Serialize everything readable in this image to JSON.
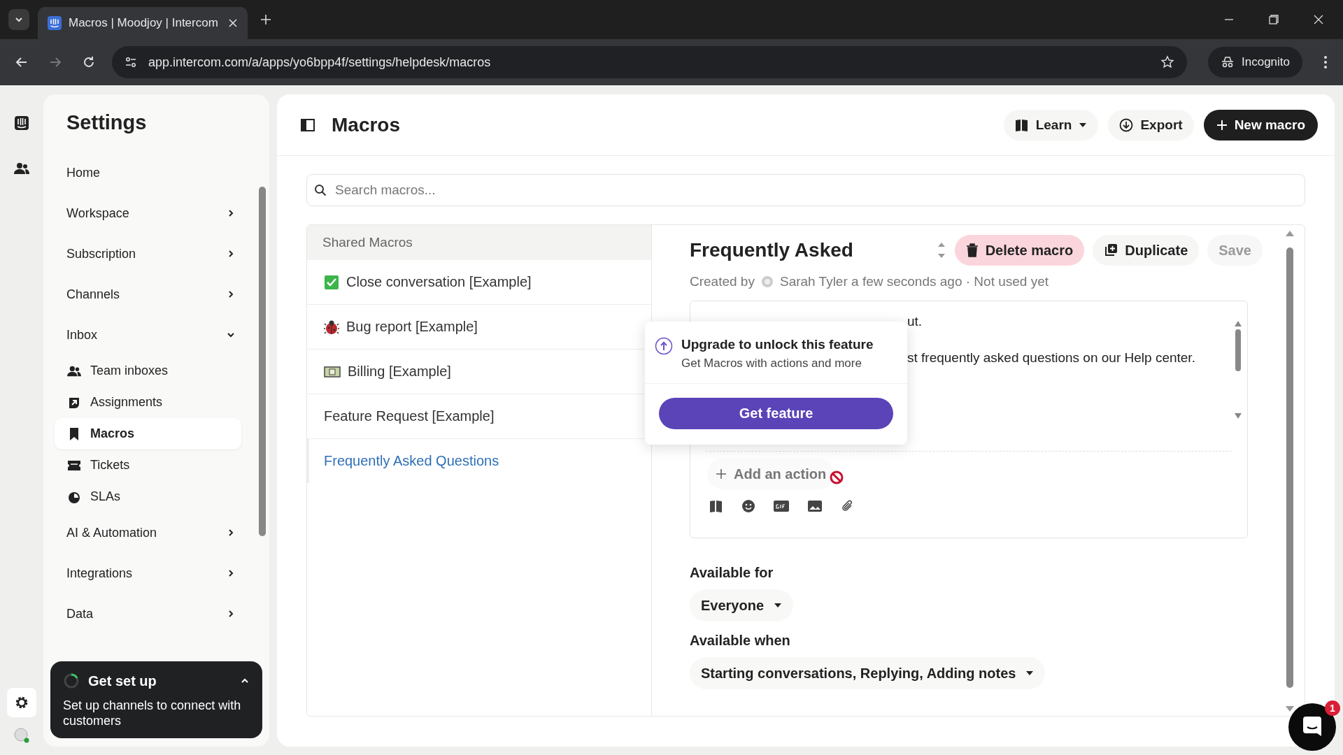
{
  "browser": {
    "tab_title": "Macros | Moodjoy | Intercom",
    "url": "app.intercom.com/a/apps/yo6bpp4f/settings/helpdesk/macros",
    "profile": "Incognito"
  },
  "settings": {
    "title": "Settings",
    "items": [
      {
        "label": "Home",
        "kind": "link"
      },
      {
        "label": "Workspace",
        "kind": "group",
        "expanded": false
      },
      {
        "label": "Subscription",
        "kind": "group",
        "expanded": false
      },
      {
        "label": "Channels",
        "kind": "group",
        "expanded": false
      },
      {
        "label": "Inbox",
        "kind": "group",
        "expanded": true,
        "children": [
          {
            "label": "Team inboxes",
            "kind": "people",
            "selected": false
          },
          {
            "label": "Assignments",
            "kind": "assign",
            "selected": false
          },
          {
            "label": "Macros",
            "kind": "bookmark",
            "selected": true
          },
          {
            "label": "Tickets",
            "kind": "ticket",
            "selected": false
          },
          {
            "label": "SLAs",
            "kind": "clock",
            "selected": false
          }
        ]
      },
      {
        "label": "AI & Automation",
        "kind": "group",
        "expanded": false
      },
      {
        "label": "Integrations",
        "kind": "group",
        "expanded": false
      },
      {
        "label": "Data",
        "kind": "group",
        "expanded": false
      }
    ]
  },
  "setup_card": {
    "title": "Get set up",
    "text": "Set up channels to connect with customers",
    "expanded": true
  },
  "page": {
    "title": "Macros",
    "buttons": [
      {
        "label": "Learn",
        "kind": "learn"
      },
      {
        "label": "Export",
        "kind": "export"
      },
      {
        "label": "New macro",
        "kind": "new"
      }
    ],
    "search": {
      "placeholder": "Search macros..."
    }
  },
  "macro_list": {
    "heading": "Shared Macros",
    "items": [
      {
        "label": "Close conversation [Example]",
        "kind": "check",
        "selected": false
      },
      {
        "label": "Bug report [Example]",
        "kind": "bug",
        "selected": false
      },
      {
        "label": "Billing [Example]",
        "kind": "bill",
        "selected": false
      },
      {
        "label": "Feature Request [Example]",
        "kind": "plain",
        "selected": false
      },
      {
        "label": "Frequently Asked Questions",
        "kind": "plain",
        "selected": true
      }
    ]
  },
  "editor": {
    "title": "Frequently Asked",
    "buttons": [
      {
        "label": "Delete macro",
        "kind": "delete",
        "disabled": false
      },
      {
        "label": "Duplicate",
        "kind": "duplicate",
        "disabled": false
      },
      {
        "label": "Save",
        "kind": "save",
        "disabled": true
      }
    ],
    "created_by": "Created by",
    "author": "Sarah Tyler",
    "meta": "a few seconds ago · Not used yet",
    "body_lines": [
      "ut.",
      "st frequently asked questions on our Help center."
    ],
    "add_action": "Add an action",
    "available_for": {
      "label": "Available for",
      "value": "Everyone"
    },
    "available_when": {
      "label": "Available when",
      "value": "Starting conversations, Replying, Adding notes"
    }
  },
  "upgrade_popover": {
    "title": "Upgrade to unlock this feature",
    "text": "Get Macros with actions and more",
    "button": "Get feature"
  },
  "messenger": {
    "badge": "1"
  }
}
